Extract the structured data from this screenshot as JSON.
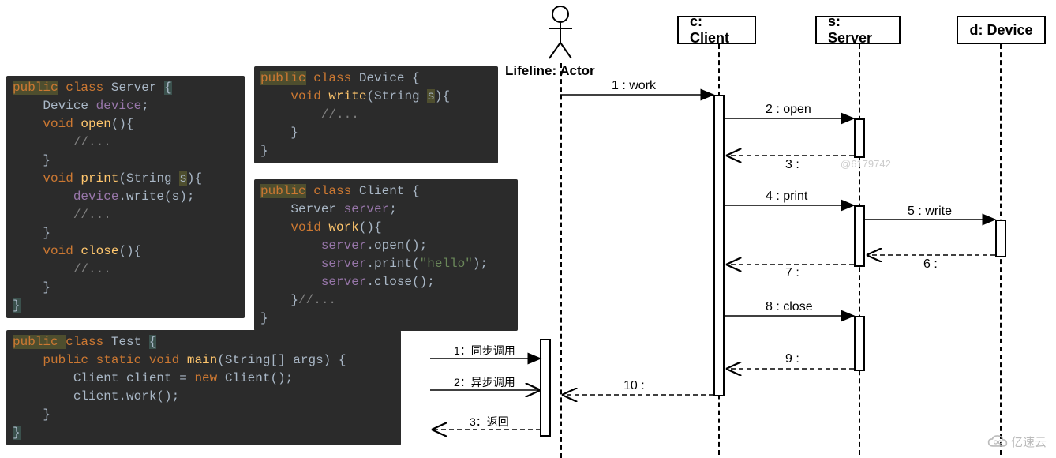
{
  "code": {
    "server": "public class Server {\n    Device device;\n    void open(){\n        //...\n    }\n    void print(String s){\n        device.write(s);\n        //...\n    }\n    void close(){\n        //...\n    }\n}",
    "device": "public class Device {\n    void write(String s){\n        //...\n    }\n}",
    "client": "public class Client {\n    Server server;\n    void work(){\n        server.open();\n        server.print(\"hello\");\n        server.close();\n    }//...\n}",
    "test": "public class Test {\n    public static void main(String[] args) {\n        Client client = new Client();\n        client.work();\n    }\n}"
  },
  "diagram": {
    "actor_label": "Lifeline: Actor",
    "participants": {
      "client": "c: Client",
      "server": "s: Server",
      "device": "d: Device"
    },
    "messages": {
      "m1": "1 : work",
      "m2": "2 : open",
      "m3": "3 :",
      "m4": "4 : print",
      "m5": "5 : write",
      "m6": "6 :",
      "m7": "7 :",
      "m8": "8 : close",
      "m9": "9 :",
      "m10": "10 :"
    },
    "watermark": "@6179742"
  },
  "legend": {
    "l1": "1：同步调用",
    "l2": "2：异步调用",
    "l3": "3：返回"
  },
  "logo_text": "亿速云"
}
